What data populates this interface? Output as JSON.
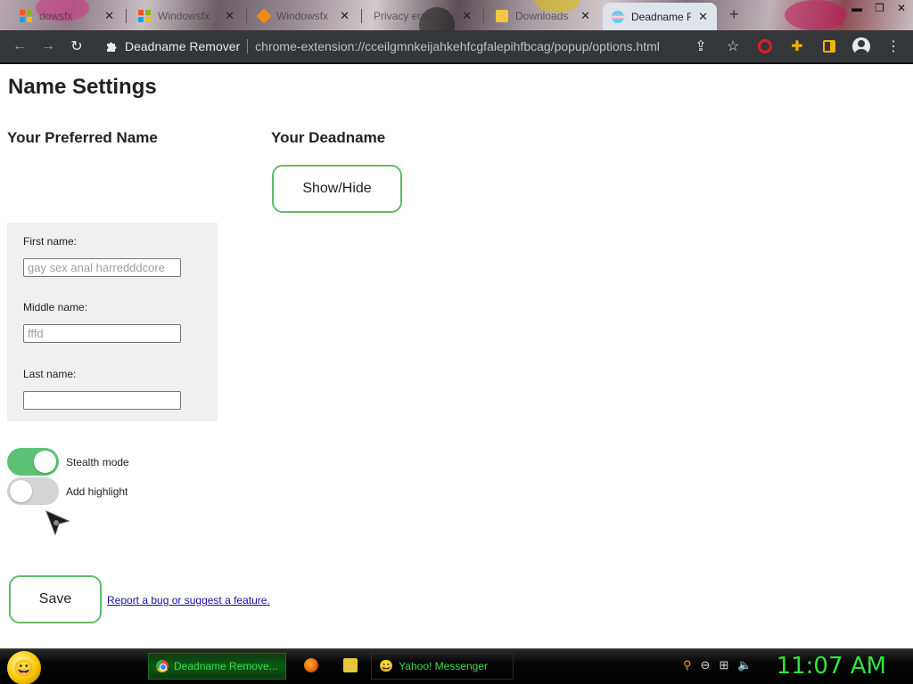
{
  "browser": {
    "tabs": [
      {
        "title": "dowsfx",
        "icon": "windows-logo-icon"
      },
      {
        "title": "Windowsfx",
        "icon": "windows-logo-icon"
      },
      {
        "title": "Windowsfx",
        "icon": "diamond-icon"
      },
      {
        "title": "Privacy error",
        "icon": "warning-icon"
      },
      {
        "title": "Downloads",
        "icon": "download-icon"
      },
      {
        "title": "Deadname R",
        "icon": "transgender-flag-icon"
      }
    ],
    "active_tab_index": 5,
    "new_tab_label": "+",
    "omnibox": {
      "extension_name": "Deadname Remover",
      "url": "chrome-extension://cceilgmnkeijahkehfcgfalepihfbcag/popup/options.html"
    }
  },
  "page": {
    "title": "Name Settings",
    "preferred_heading": "Your Preferred Name",
    "deadname_heading": "Your Deadname",
    "show_hide_label": "Show/Hide",
    "fields": {
      "first": {
        "label": "First name:",
        "placeholder": "gay sex anal harredddcore",
        "value": ""
      },
      "middle": {
        "label": "Middle name:",
        "placeholder": "fffd",
        "value": ""
      },
      "last": {
        "label": "Last name:",
        "placeholder": "",
        "value": ""
      }
    },
    "toggles": {
      "stealth": {
        "label": "Stealth mode",
        "on": true
      },
      "highlight": {
        "label": "Add highlight",
        "on": false
      }
    },
    "save_label": "Save",
    "report_link": "Report a bug or suggest a feature."
  },
  "taskbar": {
    "items": [
      {
        "label": "Deadname Remove...",
        "icon": "chrome-icon",
        "active": true
      },
      {
        "label": "Yahoo! Messenger",
        "icon": "yahoo-messenger-icon",
        "active": false
      }
    ],
    "clock": "11:07 AM"
  },
  "colors": {
    "accent_green": "#5fbb6a",
    "toggle_on": "#5cc376",
    "toggle_off": "#d4d4d4",
    "clock_green": "#2ee53c",
    "toolbar_bg": "#35363a"
  }
}
